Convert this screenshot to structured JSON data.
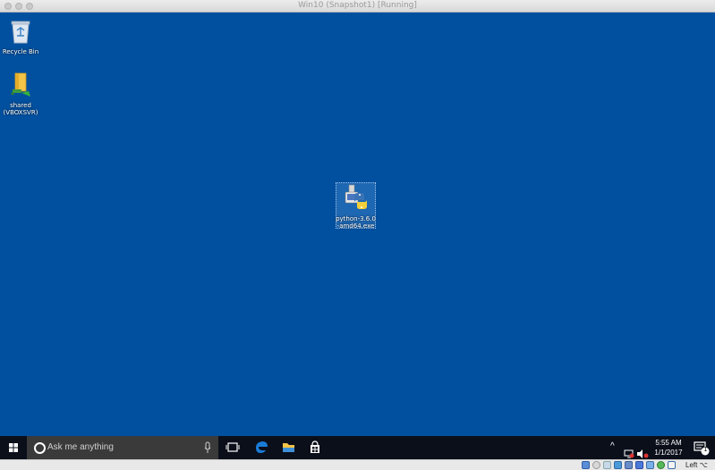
{
  "window": {
    "title": "Win10 (Snapshot1) [Running]"
  },
  "desktop_icons": [
    {
      "label": "Recycle Bin",
      "icon": "recycle-bin-icon"
    },
    {
      "label": "shared\n(VBOXSVR)",
      "icon": "network-share-icon"
    },
    {
      "label": "python-3.6.0\n-amd64.exe",
      "icon": "python-installer-icon"
    }
  ],
  "taskbar": {
    "search_placeholder": "Ask me anything",
    "apps": [
      "task-view-icon",
      "edge-icon",
      "file-explorer-icon",
      "store-icon"
    ],
    "clock": {
      "time": "5:55 AM",
      "date": "1/1/2017"
    },
    "notification_count": "1"
  },
  "vbox_status": {
    "host_key": "Left ⌥"
  },
  "colors": {
    "desktop": "#0150a0",
    "taskbar": "#0a0f1a",
    "search_box": "#3a3a3a"
  }
}
